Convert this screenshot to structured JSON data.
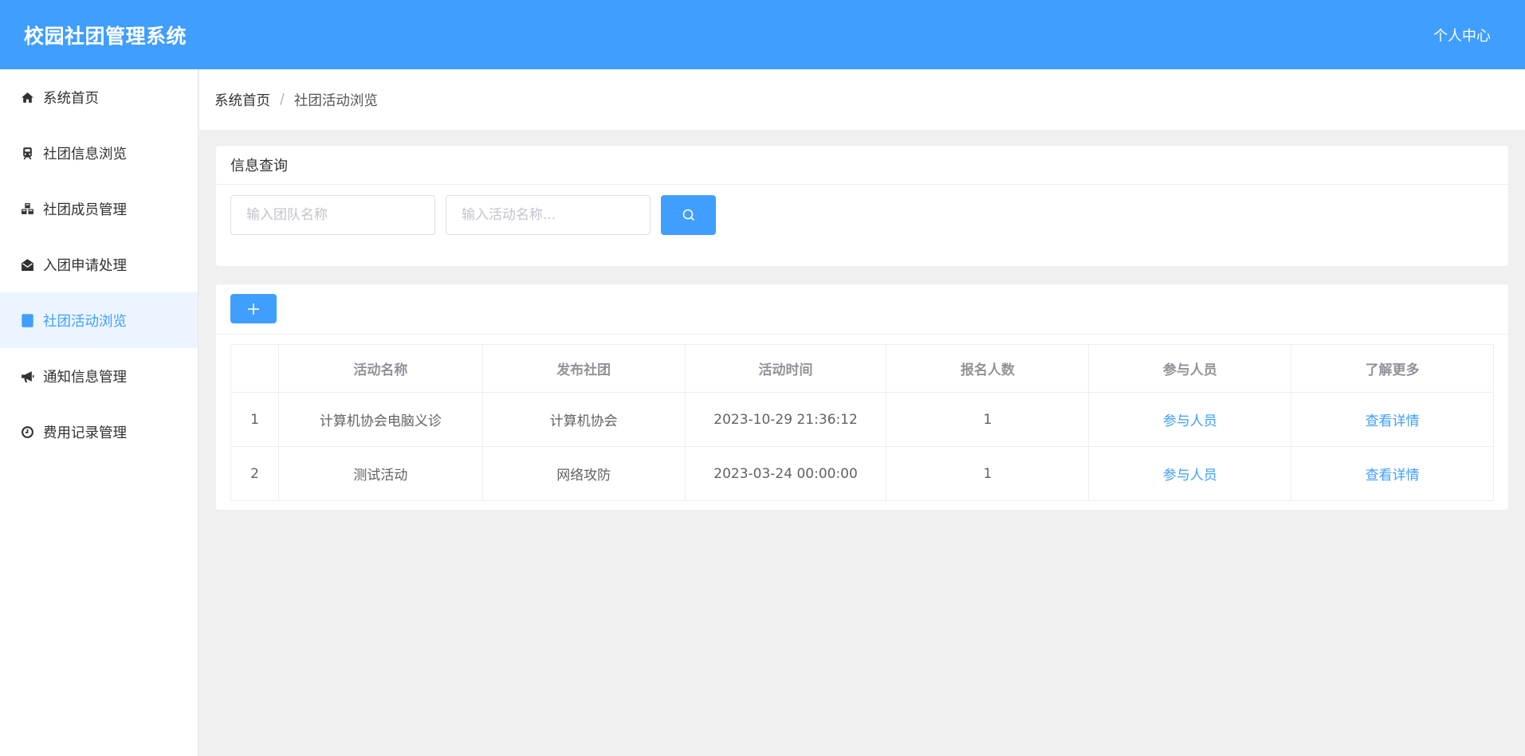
{
  "header": {
    "brand": "校园社团管理系统",
    "user_center": "个人中心"
  },
  "sidebar": {
    "items": [
      {
        "label": "系统首页",
        "icon": "home-icon"
      },
      {
        "label": "社团信息浏览",
        "icon": "train-icon"
      },
      {
        "label": "社团成员管理",
        "icon": "cubes-icon"
      },
      {
        "label": "入团申请处理",
        "icon": "envelope-open-icon"
      },
      {
        "label": "社团活动浏览",
        "icon": "calculator-icon",
        "active": true
      },
      {
        "label": "通知信息管理",
        "icon": "bullhorn-icon"
      },
      {
        "label": "费用记录管理",
        "icon": "clock-icon"
      }
    ]
  },
  "breadcrumb": {
    "home": "系统首页",
    "separator": "/",
    "current": "社团活动浏览"
  },
  "query": {
    "title": "信息查询",
    "team_placeholder": "输入团队名称",
    "activity_placeholder": "输入活动名称..."
  },
  "table": {
    "columns": [
      "",
      "活动名称",
      "发布社团",
      "活动时间",
      "报名人数",
      "参与人员",
      "了解更多"
    ],
    "rows": [
      {
        "index": "1",
        "name": "计算机协会电脑义诊",
        "club": "计算机协会",
        "time": "2023-10-29 21:36:12",
        "count": "1",
        "participants": "参与人员",
        "details": "查看详情"
      },
      {
        "index": "2",
        "name": "测试活动",
        "club": "网络攻防",
        "time": "2023-03-24 00:00:00",
        "count": "1",
        "participants": "参与人员",
        "details": "查看详情"
      }
    ]
  },
  "colors": {
    "primary": "#409eff",
    "header_bg": "#409eff",
    "active_bg": "#ecf5ff"
  }
}
